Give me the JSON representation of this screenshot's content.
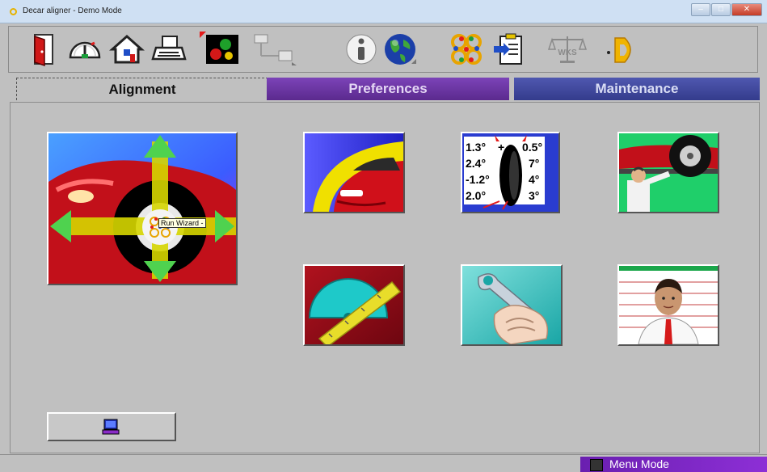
{
  "window": {
    "title": "Decar aligner - Demo Mode"
  },
  "toolbar": {
    "buttons": [
      {
        "icon": "exit-door-icon"
      },
      {
        "icon": "gauge-icon"
      },
      {
        "icon": "home-icon"
      },
      {
        "icon": "printer-icon"
      },
      {
        "icon": "display-color-icon"
      },
      {
        "icon": "network-diagram-icon"
      },
      {
        "icon": "info-icon"
      },
      {
        "icon": "globe-icon"
      },
      {
        "icon": "wizard-dots-icon"
      },
      {
        "icon": "clipboard-import-icon"
      },
      {
        "icon": "scale-wks-icon"
      },
      {
        "icon": "brand-d-logo-icon"
      }
    ],
    "scale_label": "WKS"
  },
  "tabs": [
    {
      "label": "Alignment",
      "state": "active"
    },
    {
      "label": "Preferences",
      "color": "#6a35a3"
    },
    {
      "label": "Maintenance",
      "color": "#414aa0"
    }
  ],
  "tiles": [
    {
      "name": "run-wizard",
      "tooltip": "Run Wizard -"
    },
    {
      "name": "vehicle-selection"
    },
    {
      "name": "alignment-specs",
      "values": [
        "1.3°",
        "2.4°",
        "-1.2°",
        "2.0°"
      ],
      "right_values": [
        "0.5°",
        "7°",
        "4°",
        "3°"
      ],
      "plus_prefix": "+"
    },
    {
      "name": "wheel-service"
    },
    {
      "name": "angle-measurement"
    },
    {
      "name": "adjustment-tools"
    },
    {
      "name": "customer-info"
    }
  ],
  "bottom_button": {
    "icon": "computer-icon"
  },
  "status": {
    "text": "Menu Mode",
    "color": "#7a26c4"
  }
}
